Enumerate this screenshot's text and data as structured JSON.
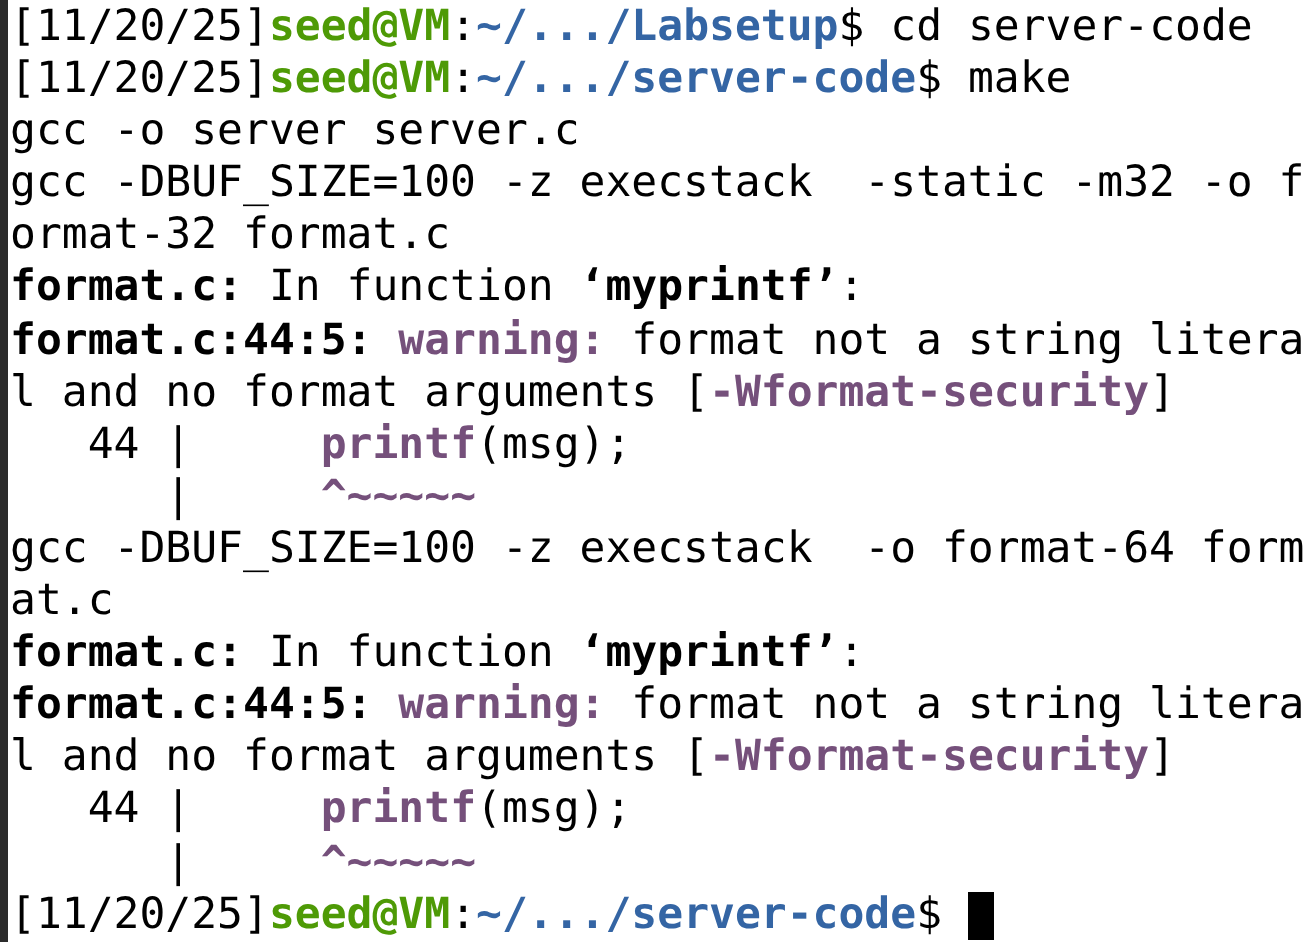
{
  "terminal": {
    "lines": [
      {
        "segments": [
          {
            "text": "[11/20/25]",
            "kind": "plain"
          },
          {
            "text": "seed@VM",
            "kind": "user"
          },
          {
            "text": ":",
            "kind": "plain"
          },
          {
            "text": "~/.../Labsetup",
            "kind": "path"
          },
          {
            "text": "$ cd server-code",
            "kind": "plain"
          }
        ]
      },
      {
        "segments": [
          {
            "text": "[11/20/25]",
            "kind": "plain"
          },
          {
            "text": "seed@VM",
            "kind": "user"
          },
          {
            "text": ":",
            "kind": "plain"
          },
          {
            "text": "~/.../server-code",
            "kind": "path"
          },
          {
            "text": "$ make",
            "kind": "plain"
          }
        ]
      },
      {
        "segments": [
          {
            "text": "gcc -o server server.c",
            "kind": "plain"
          }
        ]
      },
      {
        "segments": [
          {
            "text": "gcc -DBUF_SIZE=100 -z execstack  -static -m32 -o f",
            "kind": "plain"
          }
        ]
      },
      {
        "segments": [
          {
            "text": "ormat-32 format.c",
            "kind": "plain"
          }
        ]
      },
      {
        "segments": [
          {
            "text": "format.c:",
            "kind": "bold"
          },
          {
            "text": " In function ",
            "kind": "plain"
          },
          {
            "text": "‘myprintf’",
            "kind": "bold"
          },
          {
            "text": ":",
            "kind": "plain"
          }
        ]
      },
      {
        "segments": [
          {
            "text": "format.c:44:5:",
            "kind": "bold"
          },
          {
            "text": " warning:",
            "kind": "warn"
          },
          {
            "text": " format not a string litera",
            "kind": "plain"
          }
        ]
      },
      {
        "segments": [
          {
            "text": "l and no format arguments [",
            "kind": "plain"
          },
          {
            "text": "-Wformat-security",
            "kind": "warn"
          },
          {
            "text": "]",
            "kind": "plain"
          }
        ]
      },
      {
        "segments": [
          {
            "text": "   44 |     ",
            "kind": "plain"
          },
          {
            "text": "printf",
            "kind": "warn"
          },
          {
            "text": "(msg);",
            "kind": "plain"
          }
        ]
      },
      {
        "segments": [
          {
            "text": "      |     ",
            "kind": "plain"
          },
          {
            "text": "^~~~~~",
            "kind": "warn"
          }
        ]
      },
      {
        "segments": [
          {
            "text": "gcc -DBUF_SIZE=100 -z execstack  -o format-64 form",
            "kind": "plain"
          }
        ]
      },
      {
        "segments": [
          {
            "text": "at.c",
            "kind": "plain"
          }
        ]
      },
      {
        "segments": [
          {
            "text": "format.c:",
            "kind": "bold"
          },
          {
            "text": " In function ",
            "kind": "plain"
          },
          {
            "text": "‘myprintf’",
            "kind": "bold"
          },
          {
            "text": ":",
            "kind": "plain"
          }
        ]
      },
      {
        "segments": [
          {
            "text": "format.c:44:5:",
            "kind": "bold"
          },
          {
            "text": " warning:",
            "kind": "warn"
          },
          {
            "text": " format not a string litera",
            "kind": "plain"
          }
        ]
      },
      {
        "segments": [
          {
            "text": "l and no format arguments [",
            "kind": "plain"
          },
          {
            "text": "-Wformat-security",
            "kind": "warn"
          },
          {
            "text": "]",
            "kind": "plain"
          }
        ]
      },
      {
        "segments": [
          {
            "text": "   44 |     ",
            "kind": "plain"
          },
          {
            "text": "printf",
            "kind": "warn"
          },
          {
            "text": "(msg);",
            "kind": "plain"
          }
        ]
      },
      {
        "segments": [
          {
            "text": "      |     ",
            "kind": "plain"
          },
          {
            "text": "^~~~~~",
            "kind": "warn"
          }
        ]
      },
      {
        "segments": [
          {
            "text": "[11/20/25]",
            "kind": "plain"
          },
          {
            "text": "seed@VM",
            "kind": "user"
          },
          {
            "text": ":",
            "kind": "plain"
          },
          {
            "text": "~/.../server-code",
            "kind": "path"
          },
          {
            "text": "$ ",
            "kind": "plain"
          }
        ],
        "cursor": true
      }
    ]
  }
}
